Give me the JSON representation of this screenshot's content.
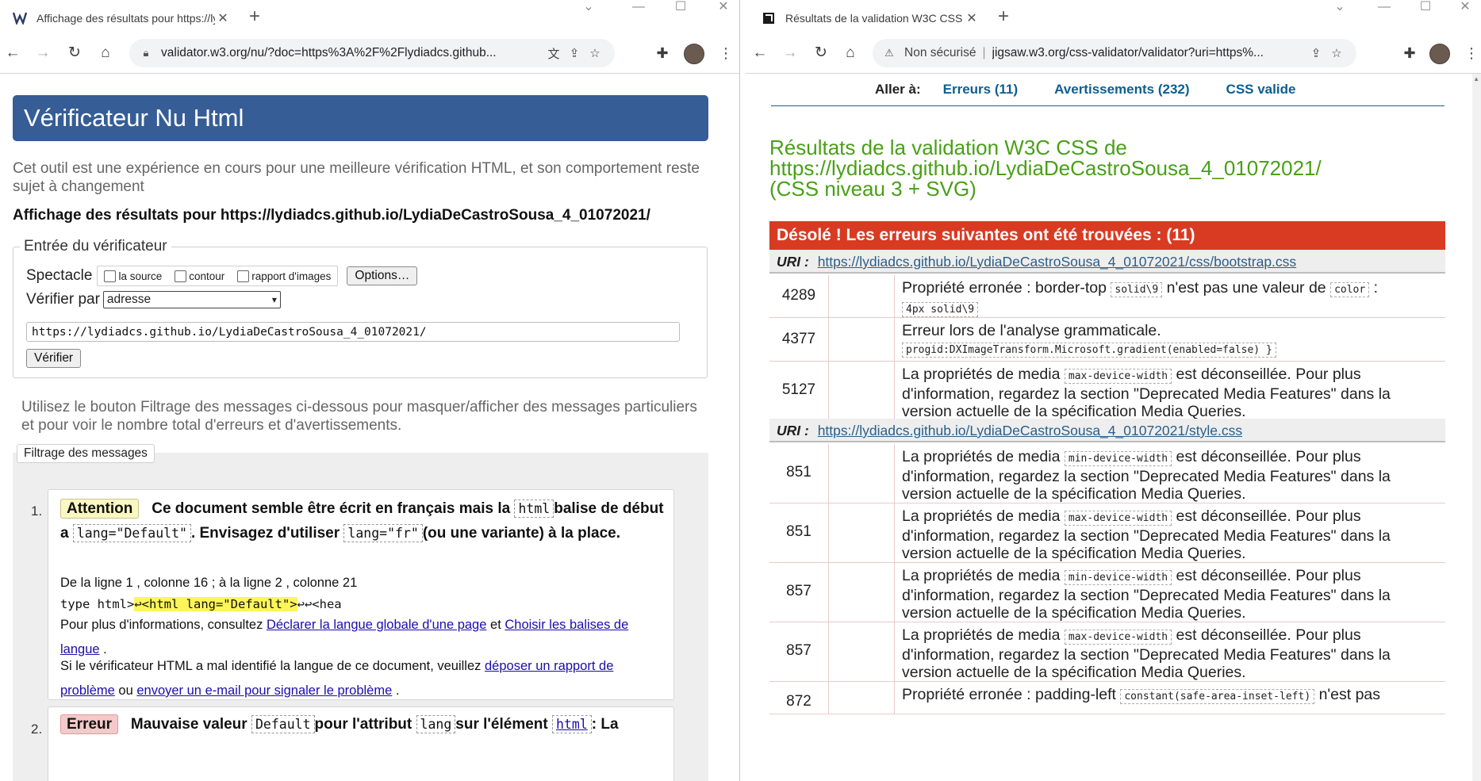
{
  "left": {
    "tab_title": "Affichage des résultats pour https://lydiadcs.github.io",
    "url": "validator.w3.org/nu/?doc=https%3A%2F%2Flydiadcs.github...",
    "header_title": "Vérificateur Nu Html",
    "intro": "Cet outil est une expérience en cours pour une meilleure vérification HTML, et son comportement reste sujet à changement",
    "showing": "Affichage des résultats pour https://lydiadcs.github.io/LydiaDeCastroSousa_4_01072021/",
    "form": {
      "legend": "Entrée du vérificateur",
      "show_label": "Spectacle",
      "opt_source": "la source",
      "opt_outline": "contour",
      "opt_images": "rapport d'images",
      "options_btn": "Options…",
      "check_by_label": "Vérifier par",
      "check_by_value": "adresse",
      "url_value": "https://lydiadcs.github.io/LydiaDeCastroSousa_4_01072021/",
      "submit": "Vérifier"
    },
    "filter_text": "Utilisez le bouton Filtrage des messages ci-dessous pour masquer/afficher des messages particuliers et pour voir le nombre total d'erreurs et d'avertissements.",
    "filter_btn": "Filtrage des messages",
    "messages": [
      {
        "num": "1.",
        "badge": "Attention",
        "t1": "Ce document semble être écrit en français mais la",
        "c1": "html",
        "t2": "balise de début a",
        "c2": "lang=\"Default\"",
        "t3": ". Envisagez d'utiliser",
        "c3": "lang=\"fr\"",
        "t4": "(ou une variante) à la place.",
        "location": "De la ligne 1 , colonne 16 ; à la ligne 2 , colonne 21",
        "extract_pre": "type html>",
        "extract_hl": "↩<html lang=\"Default\">",
        "extract_post": "↩↩<hea",
        "info_pre": "Pour plus d'informations, consultez",
        "info_link1": "Déclarer la langue globale d'une page",
        "info_mid": "et",
        "info_link2": "Choisir les balises de langue",
        "info_end": ".",
        "report_pre": "Si le vérificateur HTML a mal identifié la langue de ce document, veuillez",
        "report_link1": "déposer un rapport de problème",
        "report_mid": "ou",
        "report_link2": "envoyer un e-mail pour signaler le problème",
        "report_end": "."
      },
      {
        "num": "2.",
        "badge": "Erreur",
        "t1": "Mauvaise valeur",
        "c1": "Default",
        "t2": "pour l'attribut",
        "c2": "lang",
        "t3": "sur l'élément",
        "c3": "html",
        "t4": ": La"
      }
    ]
  },
  "right": {
    "tab_title": "Résultats de la validation W3C CSS de",
    "security": "Non sécurisé",
    "url": "jigsaw.w3.org/css-validator/validator?uri=https%...",
    "jump_label": "Aller à:",
    "jump_errors": "Erreurs (11)",
    "jump_warnings": "Avertissements (232)",
    "jump_valid": "CSS valide",
    "title_line1": "Résultats de la validation W3C CSS de",
    "title_line2": "https://lydiadcs.github.io/LydiaDeCastroSousa_4_01072021/",
    "title_line3": "(CSS niveau 3 + SVG)",
    "banner": "Désolé ! Les erreurs suivantes ont été trouvées : (11)",
    "uri_label": "URI :",
    "uri1": "https://lydiadcs.github.io/LydiaDeCastroSousa_4_01072021/css/bootstrap.css",
    "uri2": "https://lydiadcs.github.io/LydiaDeCastroSousa_4_01072021/style.css",
    "errors1": [
      {
        "line": "4289",
        "p1": "Propriété erronée : border-top",
        "v1": "solid\\9",
        "p2": "n'est pas une valeur de",
        "v2": "color",
        "p3": ":",
        "v3": "4px solid\\9"
      },
      {
        "line": "4377",
        "p1": "Erreur lors de l'analyse grammaticale.",
        "v1": "progid:DXImageTransform.Microsoft.gradient(enabled=false) }"
      },
      {
        "line": "5127",
        "p1": "La propriétés de media",
        "v1": "max-device-width",
        "p2": "est déconseillée. Pour plus d'information, regardez la section \"Deprecated Media Features\" dans la version actuelle de la spécification Media Queries."
      }
    ],
    "errors2": [
      {
        "line": "851",
        "p1": "La propriétés de media",
        "v1": "min-device-width",
        "p2": "est déconseillée. Pour plus d'information, regardez la section \"Deprecated Media Features\" dans la version actuelle de la spécification Media Queries."
      },
      {
        "line": "851",
        "p1": "La propriétés de media",
        "v1": "max-device-width",
        "p2": "est déconseillée. Pour plus d'information, regardez la section \"Deprecated Media Features\" dans la version actuelle de la spécification Media Queries."
      },
      {
        "line": "857",
        "p1": "La propriétés de media",
        "v1": "min-device-width",
        "p2": "est déconseillée. Pour plus d'information, regardez la section \"Deprecated Media Features\" dans la version actuelle de la spécification Media Queries."
      },
      {
        "line": "857",
        "p1": "La propriétés de media",
        "v1": "max-device-width",
        "p2": "est déconseillée. Pour plus d'information, regardez la section \"Deprecated Media Features\" dans la version actuelle de la spécification Media Queries."
      },
      {
        "line": "872",
        "p1": "Propriété erronée : padding-left",
        "v1": "constant(safe-area-inset-left)",
        "p2": "n'est pas"
      }
    ]
  },
  "colors": {
    "nu_header": "#365d95",
    "css_title": "#49a016",
    "error_banner": "#d83b22",
    "warn_badge": "#fbf7c0",
    "error_badge": "#f6c9c9",
    "link": "#1a0dab"
  }
}
